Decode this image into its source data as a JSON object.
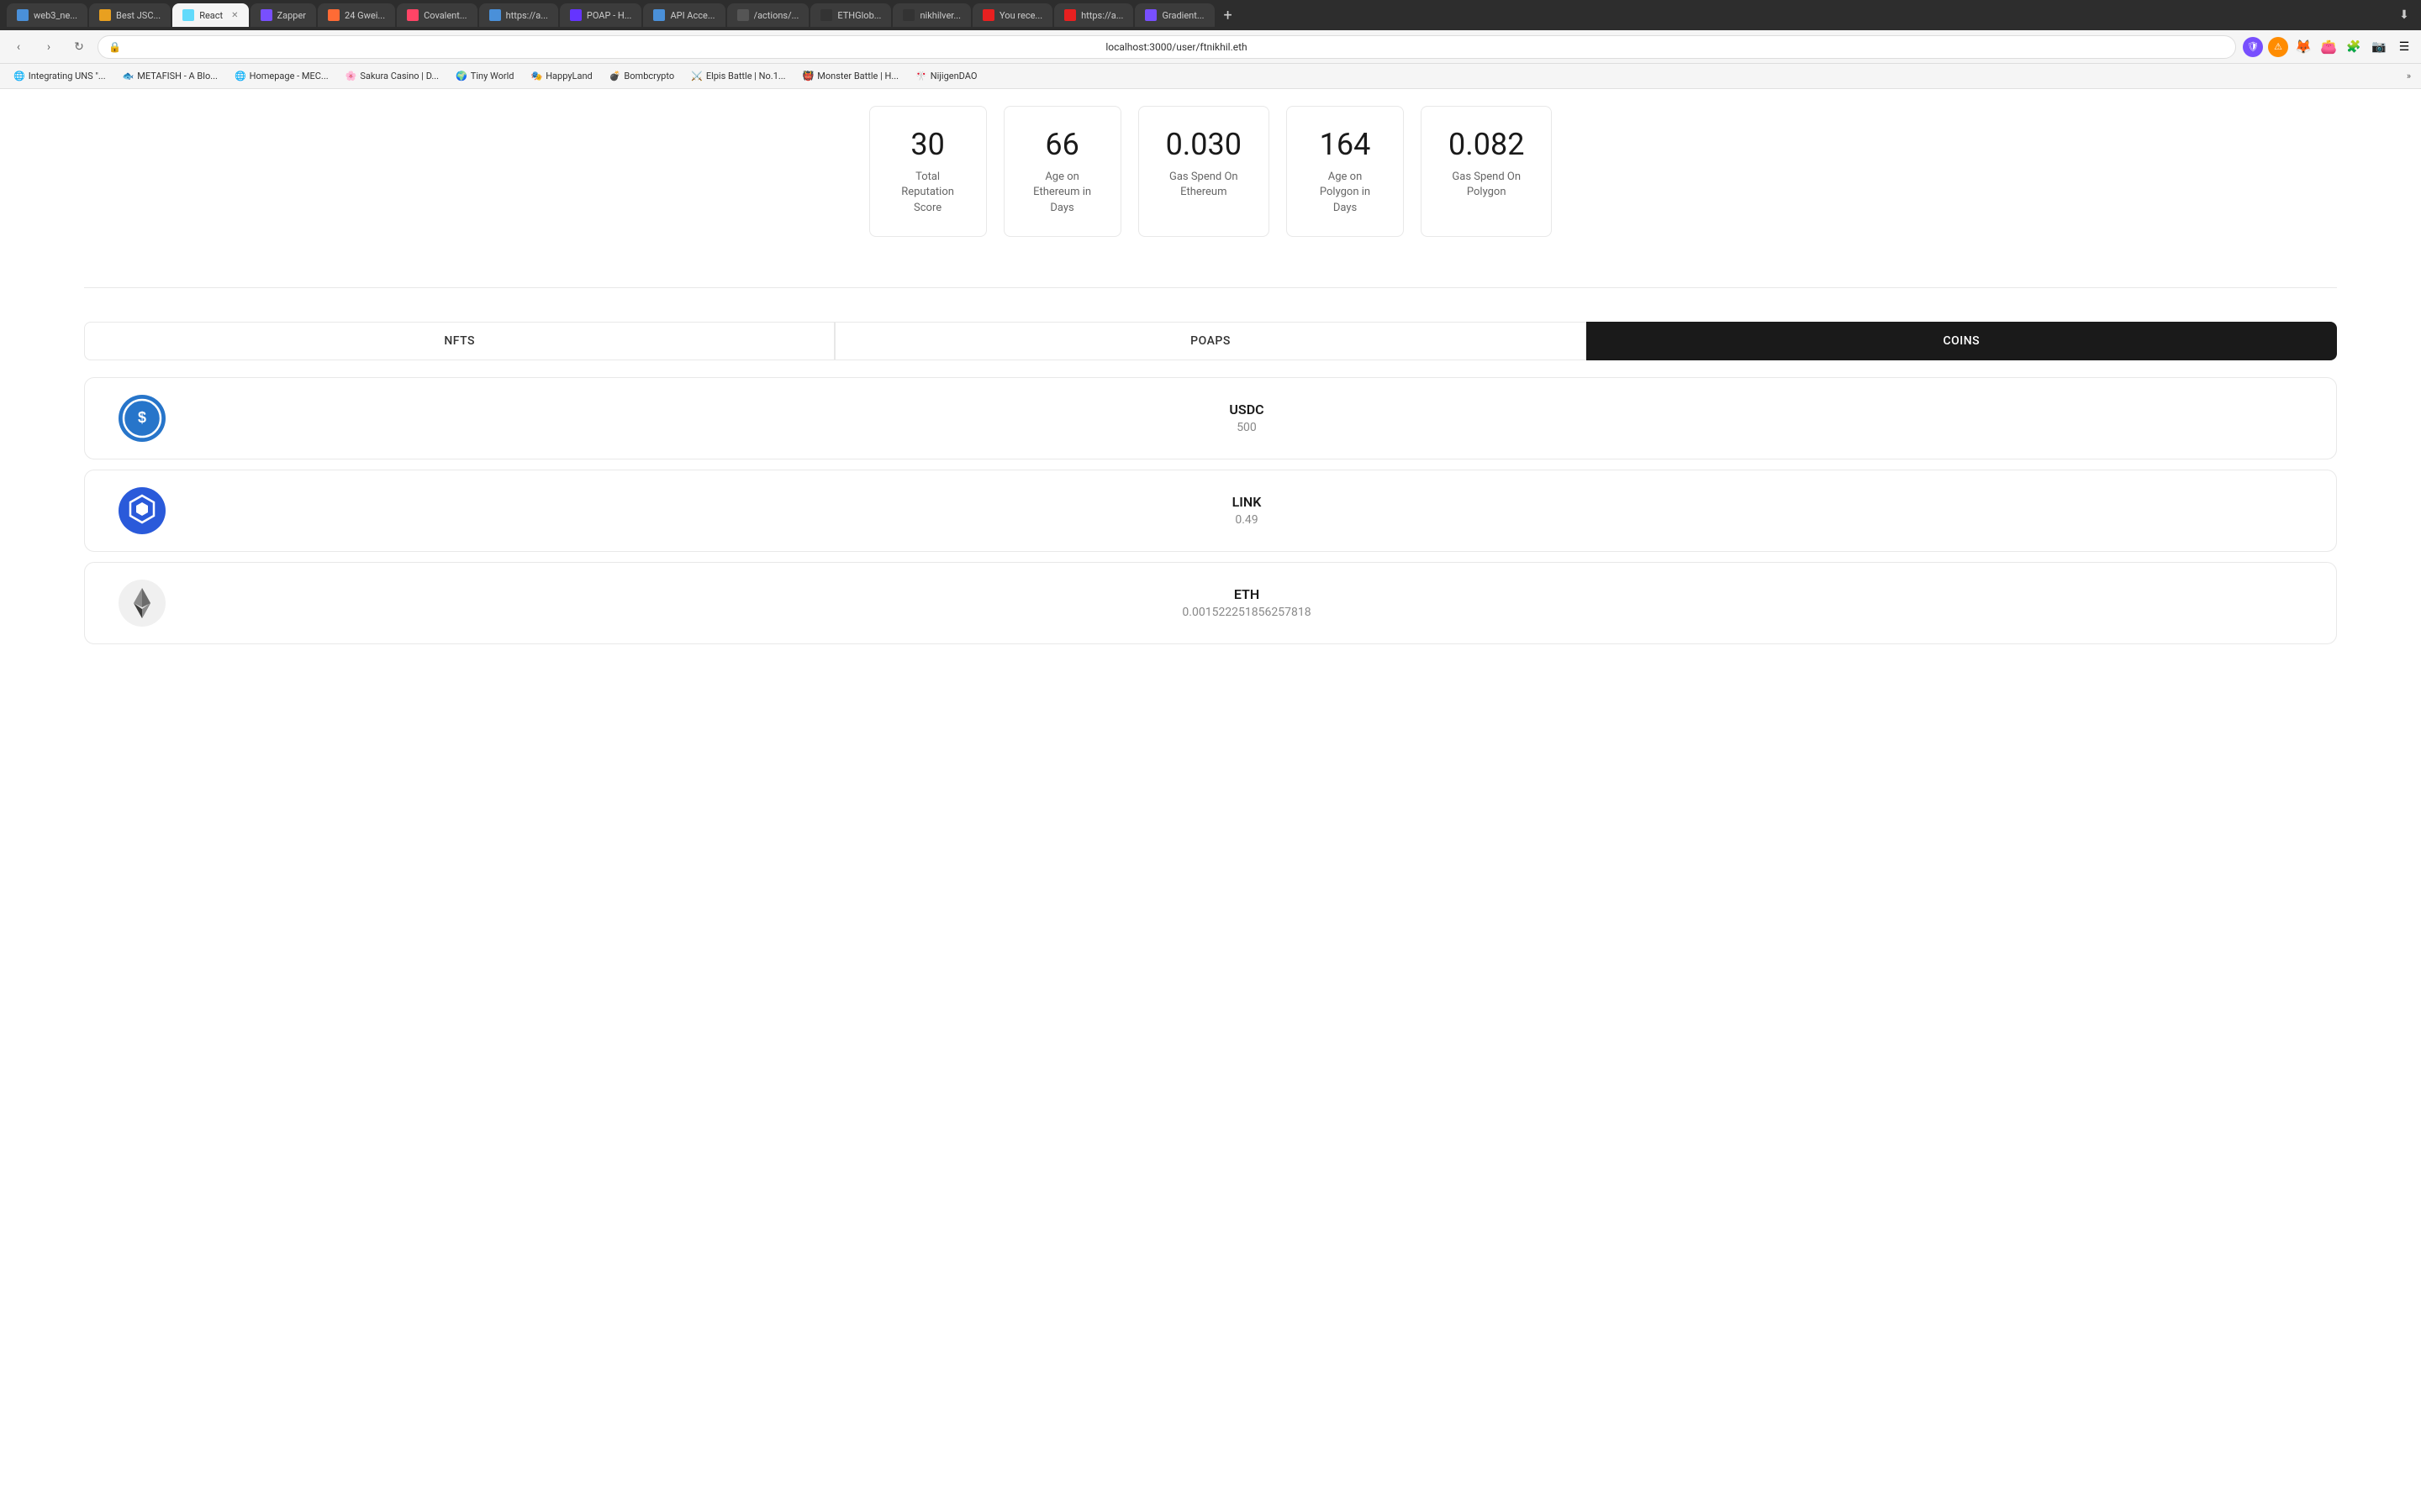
{
  "browser": {
    "tabs": [
      {
        "id": "web3",
        "label": "web3_ne...",
        "favicon_color": "#4A90D9",
        "active": false
      },
      {
        "id": "best_js",
        "label": "Best JSC...",
        "favicon_color": "#E8A020",
        "active": false
      },
      {
        "id": "react",
        "label": "React",
        "favicon_color": "#61DAFB",
        "active": true
      },
      {
        "id": "zapper",
        "label": "Zapper",
        "favicon_color": "#784FFE",
        "active": false
      },
      {
        "id": "gwei",
        "label": "24 Gwei...",
        "favicon_color": "#FF6B35",
        "active": false
      },
      {
        "id": "covalent",
        "label": "Covalent...",
        "favicon_color": "#FF4466",
        "active": false
      },
      {
        "id": "https1",
        "label": "https://a...",
        "favicon_color": "#4A90D9",
        "active": false
      },
      {
        "id": "poap",
        "label": "POAP - H...",
        "favicon_color": "#6534FF",
        "active": false
      },
      {
        "id": "api",
        "label": "API Acce...",
        "favicon_color": "#4A90D9",
        "active": false
      },
      {
        "id": "actions",
        "label": "/actions/...",
        "favicon_color": "#333",
        "active": false
      },
      {
        "id": "ethglobal",
        "label": "ETHGlob...",
        "favicon_color": "#4A90D9",
        "active": false
      },
      {
        "id": "nikhilver",
        "label": "nikhilver...",
        "favicon_color": "#333",
        "active": false
      },
      {
        "id": "youreceiv",
        "label": "You rece...",
        "favicon_color": "#E82020",
        "active": false
      },
      {
        "id": "https2",
        "label": "https://a...",
        "favicon_color": "#E82020",
        "active": false
      },
      {
        "id": "gradient",
        "label": "Gradient...",
        "favicon_color": "#784FFE",
        "active": false
      }
    ],
    "address": "localhost:3000/user/ftnikhil.eth"
  },
  "bookmarks": [
    {
      "label": "Integrating UNS \"...",
      "favicon": "🌐"
    },
    {
      "label": "METAFISH - A Blo...",
      "favicon": "🐟"
    },
    {
      "label": "Homepage - MEC...",
      "favicon": "🌐"
    },
    {
      "label": "Sakura Casino | D...",
      "favicon": "🌸"
    },
    {
      "label": "Tiny World",
      "favicon": "🌍"
    },
    {
      "label": "HappyLand",
      "favicon": "🎭"
    },
    {
      "label": "Bombcrypto",
      "favicon": "💣"
    },
    {
      "label": "Elpis Battle | No.1...",
      "favicon": "⚔️"
    },
    {
      "label": "Monster Battle | H...",
      "favicon": "👹"
    },
    {
      "label": "NijigenDAO",
      "favicon": "🎌"
    }
  ],
  "stats": [
    {
      "value": "30",
      "label": "Total\nReputation\nScore"
    },
    {
      "value": "66",
      "label": "Age on\nEthereum in\nDays"
    },
    {
      "value": "0.030",
      "label": "Gas Spend On\nEthereum"
    },
    {
      "value": "164",
      "label": "Age on\nPolygon in\nDays"
    },
    {
      "value": "0.082",
      "label": "Gas Spend On\nPolygon"
    }
  ],
  "tabs": [
    {
      "id": "nfts",
      "label": "NFTS",
      "active": false
    },
    {
      "id": "poaps",
      "label": "POAPS",
      "active": false
    },
    {
      "id": "coins",
      "label": "COINS",
      "active": true
    }
  ],
  "coins": [
    {
      "id": "usdc",
      "name": "USDC",
      "amount": "500",
      "icon_type": "usdc"
    },
    {
      "id": "link",
      "name": "LINK",
      "amount": "0.49",
      "icon_type": "link"
    },
    {
      "id": "eth",
      "name": "ETH",
      "amount": "0.001522251856257818",
      "icon_type": "eth"
    }
  ]
}
